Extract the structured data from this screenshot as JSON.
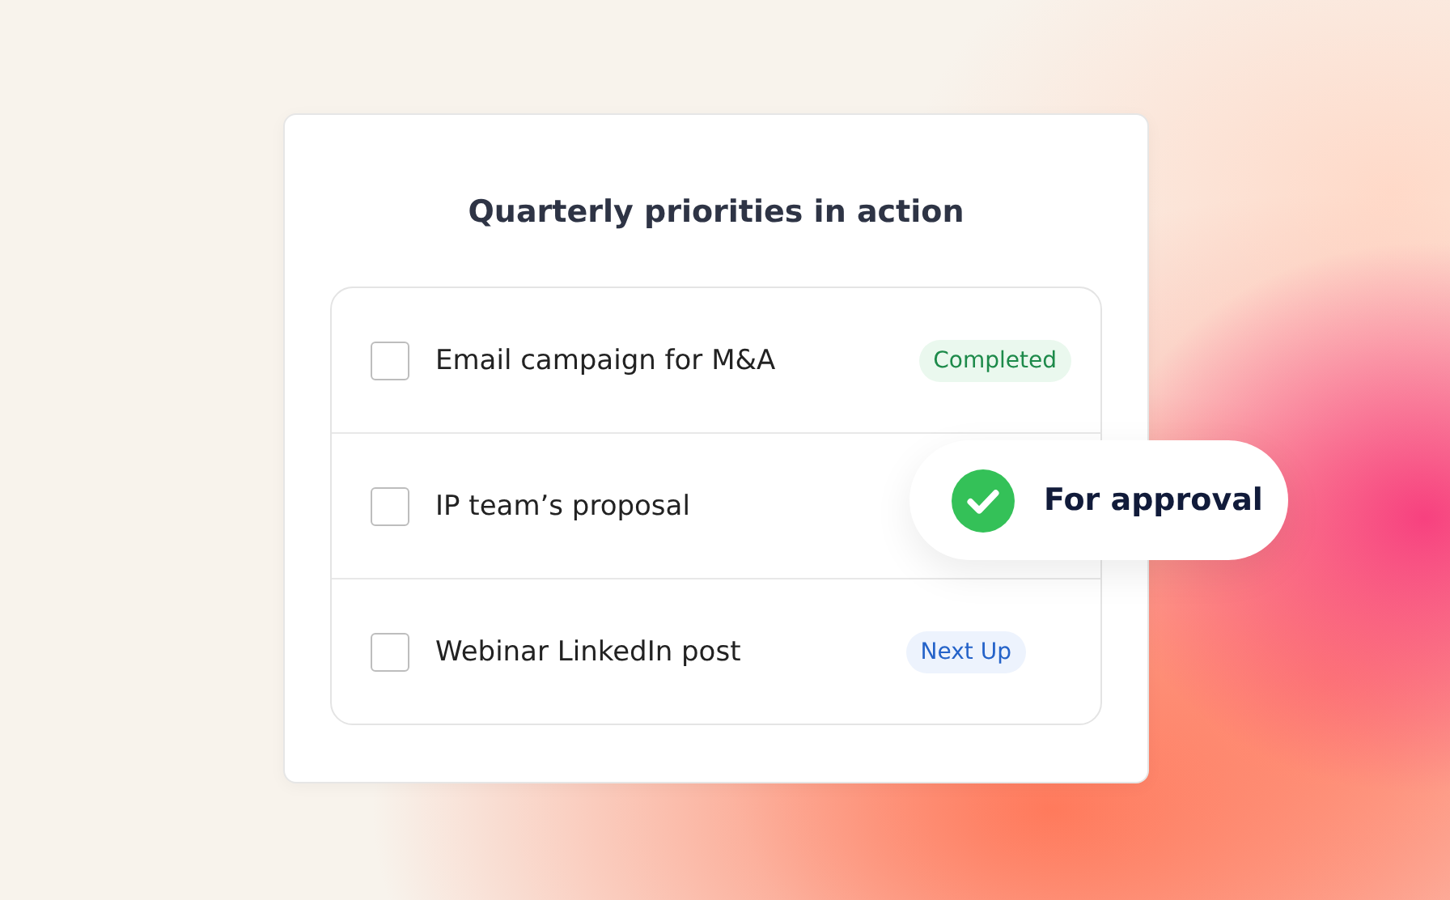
{
  "card": {
    "title": "Quarterly priorities in action",
    "tasks": [
      {
        "label": "Email campaign for M&A",
        "checked": false,
        "status": {
          "kind": "completed",
          "text": "Completed"
        }
      },
      {
        "label": "IP team’s proposal",
        "checked": false
      },
      {
        "label": "Webinar LinkedIn post",
        "checked": false,
        "status": {
          "kind": "next_up",
          "text": "Next Up"
        }
      }
    ]
  },
  "approval_pill": {
    "checked": true,
    "text": "For approval"
  }
}
